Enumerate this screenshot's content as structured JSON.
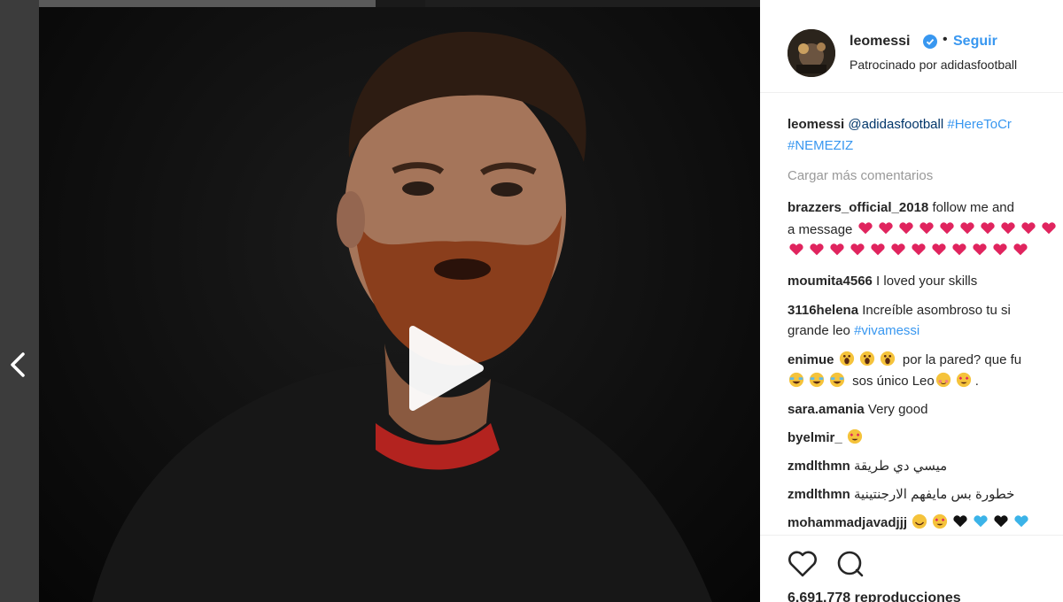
{
  "post": {
    "username": "leomessi",
    "follow_label": "Seguir",
    "sponsored_text": "Patrocinado por adidasfootball",
    "separator": "•"
  },
  "caption": {
    "username": "leomessi",
    "mention": "@adidasfootball",
    "hashtag1": "#HereToCr",
    "hashtag2": "#NEMEZIZ"
  },
  "load_more_label": "Cargar más comentarios",
  "comments": [
    {
      "user": "brazzers_official_2018",
      "line1": "follow me and",
      "line2": "a message",
      "emoji_row2": 10,
      "emoji_row3": 12
    },
    {
      "user": "moumita4566",
      "text": "I loved your skills"
    },
    {
      "user": "3116helena",
      "text": "Increíble asombroso tu si",
      "line2": "grande leo",
      "hashtag": "#vivamessi"
    },
    {
      "user": "enimue",
      "text": "por la pared? que fu",
      "line2": "sos único Leo",
      "line2_end": "."
    },
    {
      "user": "sara.amania",
      "text": "Very good"
    },
    {
      "user": "byelmir_",
      "text": ""
    },
    {
      "user": "zmdlthmn",
      "text": "ميسي دي طريقة"
    },
    {
      "user": "zmdlthmn",
      "text": "خطورة بس مايفهم الارجنتينية"
    },
    {
      "user": "mohammadjavadjjj",
      "text": ""
    }
  ],
  "views_text": "6.691.778 reproducciones",
  "icons": {
    "prev": "chevron-left-icon",
    "play": "play-icon",
    "verified": "verified-badge-icon",
    "like": "heart-icon",
    "comment": "comment-bubble-icon"
  },
  "colors": {
    "link_blue": "#3897f0",
    "hashtag_blue": "#3897f0",
    "text": "#262626",
    "muted": "#999999",
    "heart_red": "#e0245e"
  }
}
